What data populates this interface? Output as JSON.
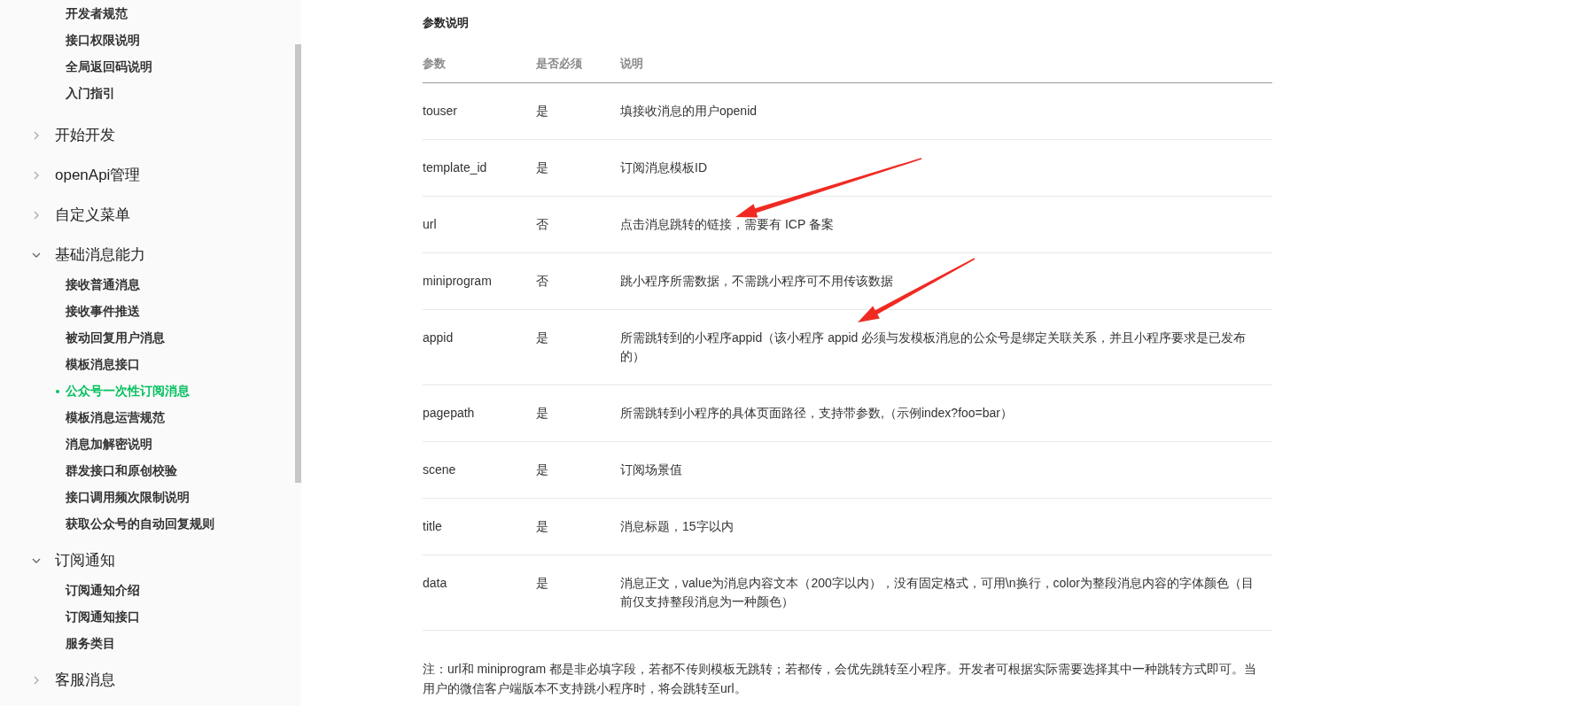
{
  "sidebar": {
    "leading_items": [
      {
        "label": "开发者规范",
        "selected": false
      },
      {
        "label": "接口权限说明",
        "selected": false
      },
      {
        "label": "全局返回码说明",
        "selected": false
      },
      {
        "label": "入门指引",
        "selected": false
      }
    ],
    "sections": [
      {
        "title": "开始开发",
        "expanded": false
      },
      {
        "title": "openApi管理",
        "expanded": false
      },
      {
        "title": "自定义菜单",
        "expanded": false
      },
      {
        "title": "基础消息能力",
        "expanded": true,
        "children": [
          {
            "label": "接收普通消息",
            "selected": false
          },
          {
            "label": "接收事件推送",
            "selected": false
          },
          {
            "label": "被动回复用户消息",
            "selected": false
          },
          {
            "label": "模板消息接口",
            "selected": false
          },
          {
            "label": "公众号一次性订阅消息",
            "selected": true
          },
          {
            "label": "模板消息运营规范",
            "selected": false
          },
          {
            "label": "消息加解密说明",
            "selected": false
          },
          {
            "label": "群发接口和原创校验",
            "selected": false
          },
          {
            "label": "接口调用频次限制说明",
            "selected": false
          },
          {
            "label": "获取公众号的自动回复规则",
            "selected": false
          }
        ]
      },
      {
        "title": "订阅通知",
        "expanded": true,
        "children": [
          {
            "label": "订阅通知介绍",
            "selected": false
          },
          {
            "label": "订阅通知接口",
            "selected": false
          },
          {
            "label": "服务类目",
            "selected": false
          }
        ]
      },
      {
        "title": "客服消息",
        "expanded": false
      }
    ]
  },
  "content": {
    "heading": "参数说明",
    "table": {
      "columns": [
        "参数",
        "是否必须",
        "说明"
      ],
      "rows": [
        {
          "param": "touser",
          "required": "是",
          "description": "填接收消息的用户openid"
        },
        {
          "param": "template_id",
          "required": "是",
          "description": "订阅消息模板ID"
        },
        {
          "param": "url",
          "required": "否",
          "description": "点击消息跳转的链接，需要有 ICP 备案"
        },
        {
          "param": "miniprogram",
          "required": "否",
          "description": "跳小程序所需数据，不需跳小程序可不用传该数据"
        },
        {
          "param": "appid",
          "required": "是",
          "description": "所需跳转到的小程序appid（该小程序 appid 必须与发模板消息的公众号是绑定关联关系，并且小程序要求是已发布的）"
        },
        {
          "param": "pagepath",
          "required": "是",
          "description": "所需跳转到小程序的具体页面路径，支持带参数,（示例index?foo=bar）"
        },
        {
          "param": "scene",
          "required": "是",
          "description": "订阅场景值"
        },
        {
          "param": "title",
          "required": "是",
          "description": "消息标题，15字以内"
        },
        {
          "param": "data",
          "required": "是",
          "description": "消息正文，value为消息内容文本（200字以内），没有固定格式，可用\\n换行，color为整段消息内容的字体颜色（目前仅支持整段消息为一种颜色）"
        }
      ]
    },
    "note": "注：url和 miniprogram 都是非必填字段，若都不传则模板无跳转；若都传，会优先跳转至小程序。开发者可根据实际需要选择其中一种跳转方式即可。当用户的微信客户端版本不支持跳小程序时，将会跳转至url。"
  }
}
